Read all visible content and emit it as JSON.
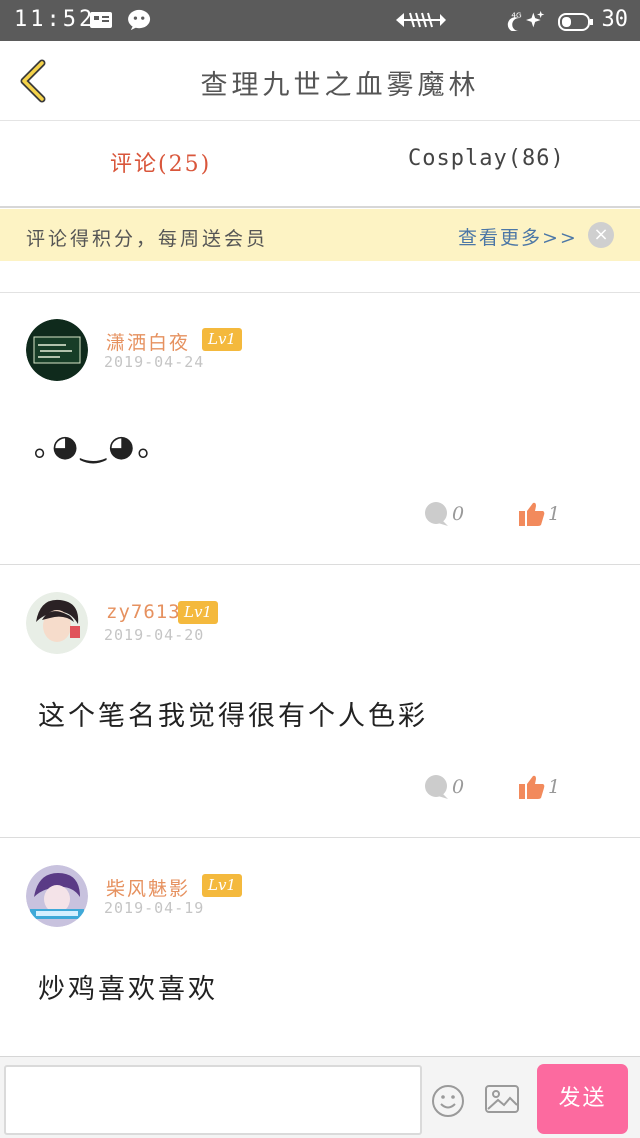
{
  "status_bar": {
    "time": "11:52",
    "battery": "30",
    "icons": [
      "sim-card-icon",
      "wechat-icon",
      "fishbone-icon",
      "moon-icon",
      "4g-signal-icon",
      "battery-icon"
    ]
  },
  "header": {
    "title": "查理九世之血雾魔林",
    "back_icon": "chevron-left-icon"
  },
  "tabs": [
    {
      "label": "评论(25)",
      "active": true
    },
    {
      "label": "Cosplay(86)",
      "active": false
    }
  ],
  "notice": {
    "text": "评论得积分，每周送会员",
    "more": "查看更多>>",
    "close": "×"
  },
  "comments": [
    {
      "username": "潇洒白夜",
      "level": "Lv1",
      "date": "2019-04-24",
      "text": "｡◕‿◕｡",
      "replies": "0",
      "likes": "1",
      "avatar_icon": "avatar-chalkboard-icon"
    },
    {
      "username": "zy7613",
      "level": "Lv1",
      "date": "2019-04-20",
      "text": "这个笔名我觉得很有个人色彩",
      "replies": "0",
      "likes": "1",
      "avatar_icon": "avatar-portrait-icon"
    },
    {
      "username": "柴风魅影",
      "level": "Lv1",
      "date": "2019-04-19",
      "text": "炒鸡喜欢喜欢",
      "replies": "",
      "likes": "",
      "avatar_icon": "avatar-anime-icon"
    }
  ],
  "composer": {
    "input_value": "",
    "send_label": "发送",
    "emoji_icon": "smiley-icon",
    "image_icon": "image-icon"
  },
  "colors": {
    "accent": "#d9563b",
    "username": "#e6915f",
    "level_badge": "#f4b93d",
    "send_button": "#fc6a9f",
    "notice_bg": "#fdf3c4",
    "link": "#4c77a6"
  }
}
